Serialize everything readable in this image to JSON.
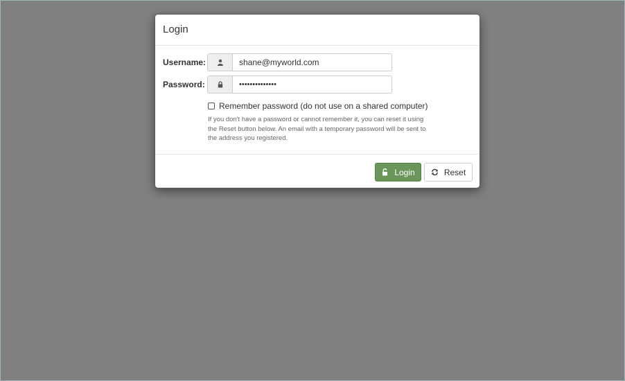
{
  "dialog": {
    "title": "Login"
  },
  "form": {
    "username": {
      "label": "Username:",
      "value": "shane@myworld.com",
      "icon": "user-icon"
    },
    "password": {
      "label": "Password:",
      "value": "••••••••••••••",
      "icon": "lock-icon"
    },
    "remember": {
      "label": "Remember password (do not use on a shared computer)",
      "checked": false
    },
    "help_text": "If you don't have a password or cannot remember it, you can reset it using the Reset button below. An email with a temporary password will be sent to the address you registered."
  },
  "footer": {
    "login_label": "Login",
    "login_icon": "unlock-icon",
    "reset_label": "Reset",
    "reset_icon": "refresh-icon"
  },
  "colors": {
    "backdrop": "#808080",
    "primary_button": "#6a965a"
  }
}
